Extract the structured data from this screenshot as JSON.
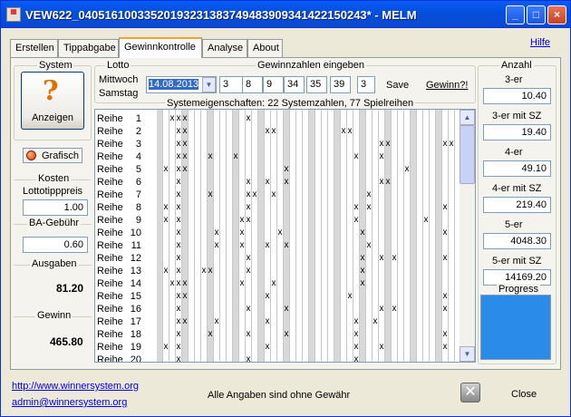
{
  "window": {
    "title": "VEW622_0405161003352019323138374948390934142215024​3* - MELM",
    "min": "_",
    "max": "□",
    "close": "×"
  },
  "tabs": [
    "Erstellen",
    "Tippabgabe",
    "Gewinnkontrolle",
    "Analyse",
    "About"
  ],
  "active_tab": "Gewinnkontrolle",
  "help_link": "Hilfe",
  "system": {
    "title": "System",
    "button": "Anzeigen",
    "grafisch": "Grafisch",
    "kosten_title": "Kosten",
    "lottotipppreis_label": "Lottotipppreis",
    "lottotipppreis": "1.00",
    "ba_label": "BA-Gebühr",
    "ba_value": "0.60",
    "ausgaben_label": "Ausgaben",
    "ausgaben": "81.20",
    "gewinn_label": "Gewinn",
    "gewinn": "465.80"
  },
  "lotto": {
    "title": "Lotto",
    "days": [
      "Mittwoch",
      "Samstag"
    ],
    "date": "14.08.2013",
    "winning_title": "Gewinnzahlen eingeben",
    "numbers": [
      "3",
      "8",
      "9",
      "34",
      "35",
      "39"
    ],
    "superzahl": "3",
    "save": "Save",
    "gewinn": "Gewinn?!"
  },
  "system_info": "Systemeigenschaften: 22 Systemzahlen, 77 Spielreihen",
  "rows": [
    {
      "label": "Reihe",
      "num": "1",
      "marks": [
        2,
        3,
        4,
        14
      ]
    },
    {
      "label": "Reihe",
      "num": "2",
      "marks": [
        3,
        4,
        17,
        18,
        29,
        30
      ]
    },
    {
      "label": "Reihe",
      "num": "3",
      "marks": [
        3,
        4,
        35,
        36,
        45,
        46
      ]
    },
    {
      "label": "Reihe",
      "num": "4",
      "marks": [
        3,
        4,
        8,
        12,
        31,
        35
      ]
    },
    {
      "label": "Reihe",
      "num": "5",
      "marks": [
        1,
        3,
        4,
        20,
        39
      ]
    },
    {
      "label": "Reihe",
      "num": "6",
      "marks": [
        3,
        14,
        17,
        20,
        35,
        36
      ]
    },
    {
      "label": "Reihe",
      "num": "7",
      "marks": [
        3,
        8,
        14,
        15,
        18,
        33
      ]
    },
    {
      "label": "Reihe",
      "num": "8",
      "marks": [
        1,
        3,
        14,
        31,
        33,
        45
      ]
    },
    {
      "label": "Reihe",
      "num": "9",
      "marks": [
        1,
        3,
        13,
        14,
        31,
        42
      ]
    },
    {
      "label": "Reihe",
      "num": "10",
      "marks": [
        3,
        9,
        13,
        19,
        32,
        45
      ]
    },
    {
      "label": "Reihe",
      "num": "11",
      "marks": [
        3,
        9,
        13,
        17,
        20,
        33
      ]
    },
    {
      "label": "Reihe",
      "num": "12",
      "marks": [
        3,
        14,
        32,
        35,
        37,
        45
      ]
    },
    {
      "label": "Reihe",
      "num": "13",
      "marks": [
        1,
        3,
        7,
        8,
        14,
        32
      ]
    },
    {
      "label": "Reihe",
      "num": "14",
      "marks": [
        2,
        3,
        4,
        13,
        18,
        32
      ]
    },
    {
      "label": "Reihe",
      "num": "15",
      "marks": [
        3,
        4,
        17,
        30,
        45
      ]
    },
    {
      "label": "Reihe",
      "num": "16",
      "marks": [
        3,
        14,
        20,
        35,
        37,
        45
      ]
    },
    {
      "label": "Reihe",
      "num": "17",
      "marks": [
        3,
        4,
        9,
        17,
        31,
        34
      ]
    },
    {
      "label": "Reihe",
      "num": "18",
      "marks": [
        3,
        8,
        14,
        20,
        31,
        45
      ]
    },
    {
      "label": "Reihe",
      "num": "19",
      "marks": [
        1,
        3,
        17,
        31,
        35,
        45
      ]
    },
    {
      "label": "Reihe",
      "num": "20",
      "marks": [
        3,
        14,
        31
      ]
    }
  ],
  "anzahl": {
    "title": "Anzahl",
    "items": [
      {
        "label": "3-er",
        "value": "10.40"
      },
      {
        "label": "3-er mit SZ",
        "value": "19.40"
      },
      {
        "label": "4-er",
        "value": "49.10"
      },
      {
        "label": "4-er mit SZ",
        "value": "219.40"
      },
      {
        "label": "5-er",
        "value": "4048.30"
      },
      {
        "label": "5-er mit SZ",
        "value": "14169.20"
      }
    ],
    "progress_label": "Progress",
    "progress": 1.0,
    "progress_color": "#2b8be8"
  },
  "footer": {
    "url": "http://www.winnersystem.org",
    "email": "admin@winnersystem.org",
    "disclaimer": "Alle Angaben sind ohne Gewähr",
    "close": "Close"
  },
  "icons": {
    "question": "question-mark-icon",
    "close": "close-x-icon"
  }
}
